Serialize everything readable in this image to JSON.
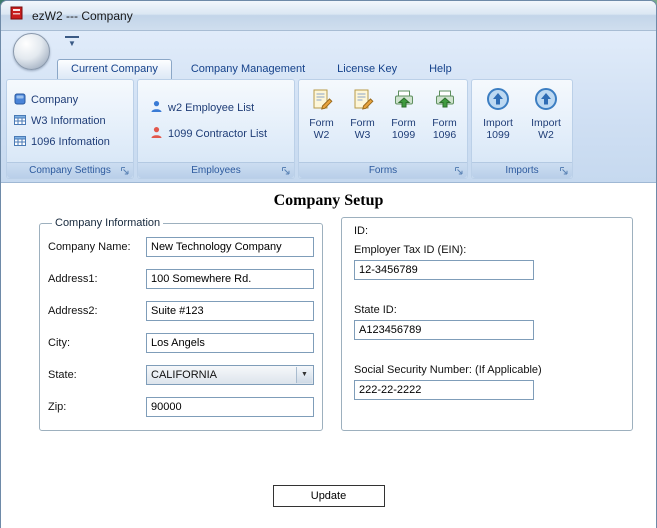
{
  "window": {
    "title": "ezW2 --- Company"
  },
  "ribbon": {
    "tabs": [
      {
        "label": "Current Company"
      },
      {
        "label": "Company Management"
      },
      {
        "label": "License Key"
      },
      {
        "label": "Help"
      }
    ],
    "groups": {
      "company_settings": {
        "caption": "Company Settings",
        "items": [
          {
            "label": "Company"
          },
          {
            "label": "W3 Information"
          },
          {
            "label": "1096 Infomation"
          }
        ]
      },
      "employees": {
        "caption": "Employees",
        "items": [
          {
            "label": "w2 Employee List"
          },
          {
            "label": "1099 Contractor List"
          }
        ]
      },
      "forms": {
        "caption": "Forms",
        "buttons": [
          {
            "line1": "Form",
            "line2": "W2"
          },
          {
            "line1": "Form",
            "line2": "W3"
          },
          {
            "line1": "Form",
            "line2": "1099"
          },
          {
            "line1": "Form",
            "line2": "1096"
          }
        ]
      },
      "imports": {
        "caption": "Imports",
        "buttons": [
          {
            "line1": "Import",
            "line2": "1099"
          },
          {
            "line1": "Import",
            "line2": "W2"
          }
        ]
      }
    }
  },
  "main": {
    "title": "Company Setup",
    "company_info": {
      "legend": "Company Information",
      "fields": [
        {
          "label": "Company Name:",
          "value": "New Technology Company"
        },
        {
          "label": "Address1:",
          "value": "100 Somewhere Rd."
        },
        {
          "label": "Address2:",
          "value": "Suite #123"
        },
        {
          "label": "City:",
          "value": "Los Angels"
        },
        {
          "label": "State:",
          "value": "CALIFORNIA"
        },
        {
          "label": "Zip:",
          "value": "90000"
        }
      ]
    },
    "id_info": {
      "heading": "ID:",
      "fields": [
        {
          "label": "Employer Tax ID (EIN):",
          "value": "12-3456789"
        },
        {
          "label": "State ID:",
          "value": "A123456789"
        },
        {
          "label": "Social Security Number: (If Applicable)",
          "value": "222-22-2222"
        }
      ]
    },
    "update_label": "Update"
  },
  "colors": {
    "ribbon_text_blue": "#15428b",
    "logo_red": "#c81e1e",
    "desktop_teal": "#3c7b6b"
  }
}
